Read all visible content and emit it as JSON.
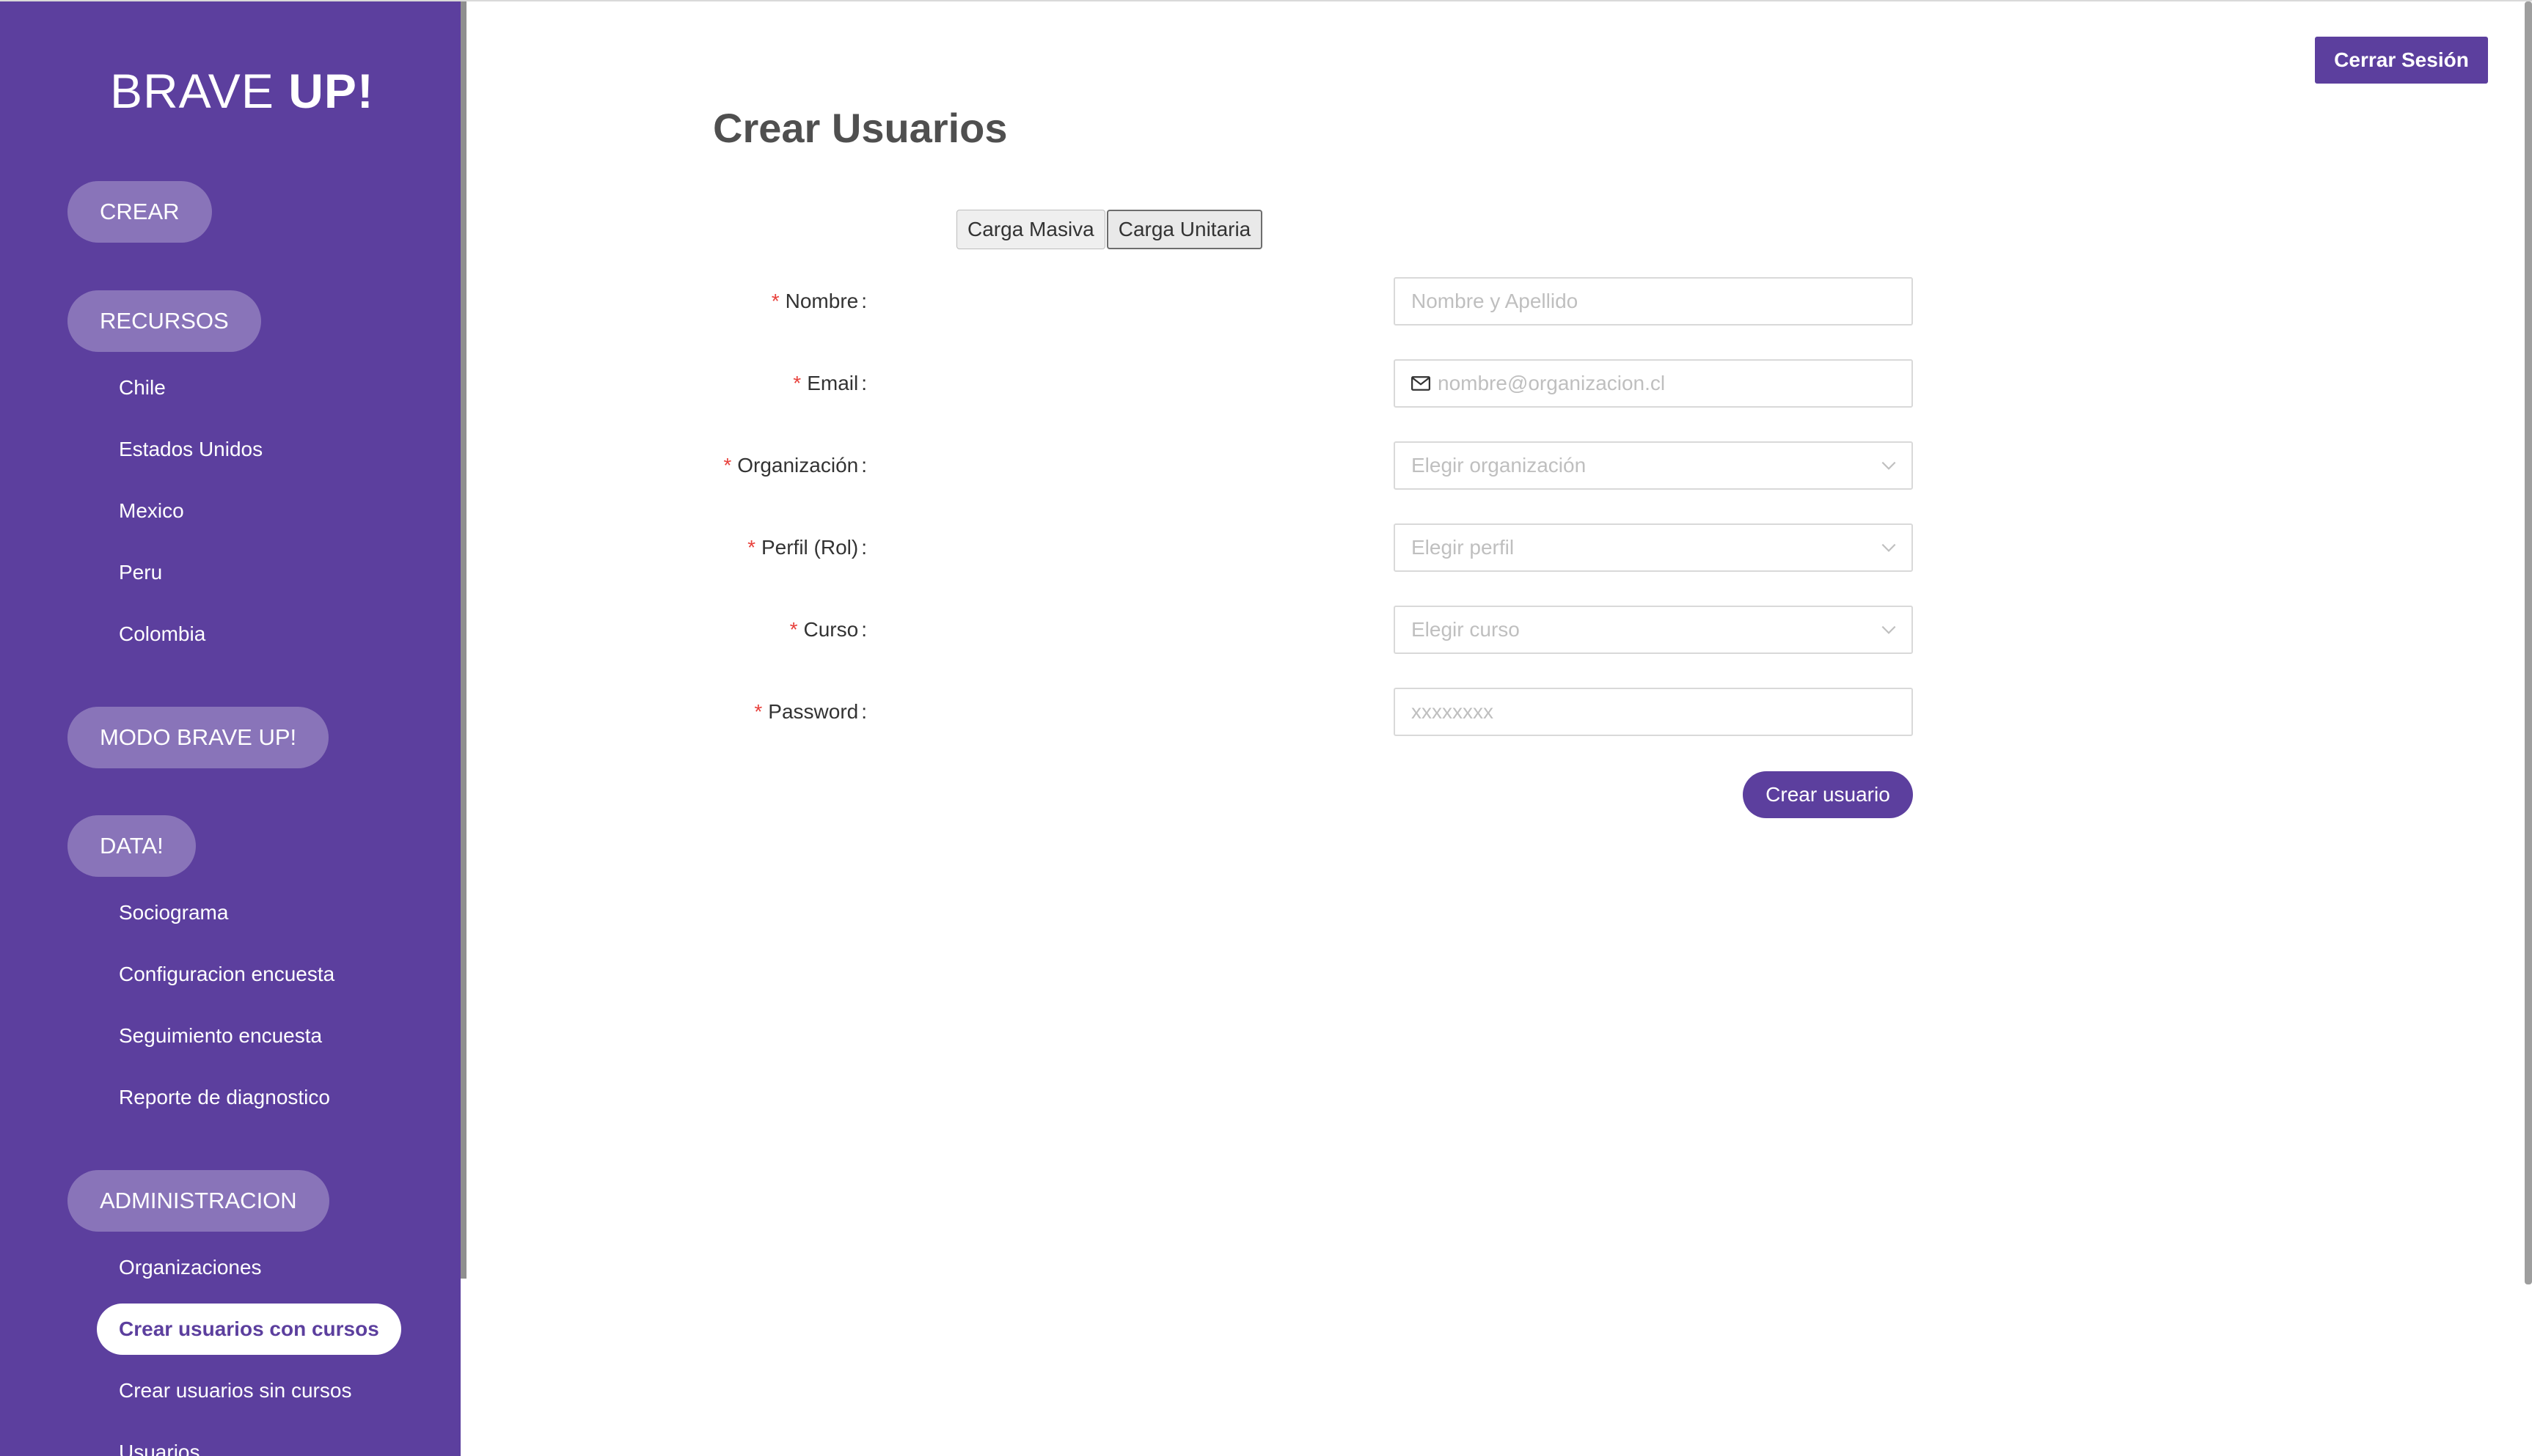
{
  "brand": {
    "logo_light": "BRAVE ",
    "logo_bold": "UP!"
  },
  "sidebar": {
    "groups": [
      {
        "label": "CREAR"
      },
      {
        "label": "RECURSOS",
        "items": [
          "Chile",
          "Estados Unidos",
          "Mexico",
          "Peru",
          "Colombia"
        ]
      },
      {
        "label": "MODO BRAVE UP!"
      },
      {
        "label": "DATA!",
        "items": [
          "Sociograma",
          "Configuracion encuesta",
          "Seguimiento encuesta",
          "Reporte de diagnostico"
        ]
      },
      {
        "label": "ADMINISTRACION",
        "items": [
          "Organizaciones",
          "Crear usuarios con cursos",
          "Crear usuarios sin cursos",
          "Usuarios"
        ]
      }
    ],
    "active_item": "Crear usuarios con cursos"
  },
  "header": {
    "logout_label": "Cerrar Sesión"
  },
  "main": {
    "title": "Crear Usuarios",
    "tabs": [
      {
        "label": "Carga Masiva",
        "selected": false
      },
      {
        "label": "Carga Unitaria",
        "selected": true
      }
    ],
    "form": {
      "required_mark": "*",
      "colon": ":",
      "fields": {
        "nombre": {
          "label": "Nombre",
          "placeholder": "Nombre y Apellido",
          "value": ""
        },
        "email": {
          "label": "Email",
          "placeholder": "nombre@organizacion.cl",
          "value": ""
        },
        "organizacion": {
          "label": "Organización",
          "placeholder": "Elegir organización"
        },
        "perfil": {
          "label": "Perfil (Rol)",
          "placeholder": "Elegir perfil"
        },
        "curso": {
          "label": "Curso",
          "placeholder": "Elegir curso"
        },
        "password": {
          "label": "Password",
          "placeholder": "xxxxxxxx",
          "value": ""
        }
      },
      "submit_label": "Crear usuario"
    }
  },
  "colors": {
    "brand_purple": "#5c3f9e",
    "required_red": "#e8413c"
  },
  "icons": {
    "email_field": "mail-icon",
    "select_fields": "chevron-down-icon"
  }
}
